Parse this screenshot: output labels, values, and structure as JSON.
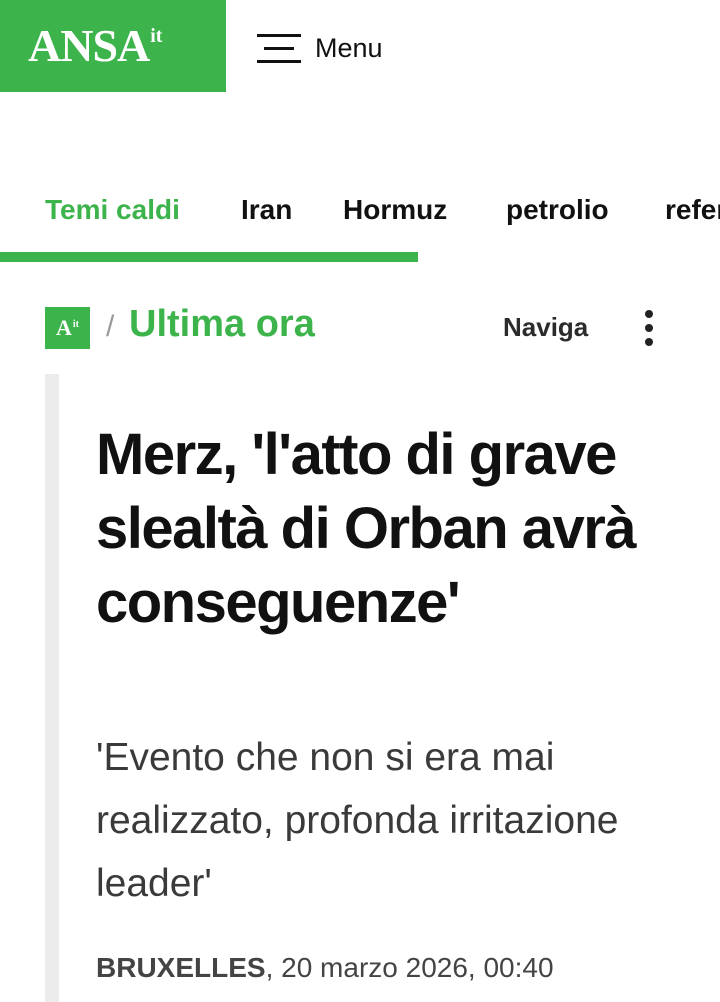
{
  "colors": {
    "brand_green": "#3cb44b"
  },
  "header": {
    "logo_text": "ANSA",
    "logo_superscript": "it",
    "menu_icon": "hamburger-icon",
    "menu_label": "Menu"
  },
  "topics": {
    "items": [
      "Temi caldi",
      "Iran",
      "Hormuz",
      "petrolio",
      "referendum"
    ],
    "active": "Temi caldi"
  },
  "breadcrumb": {
    "badge_text": "A",
    "badge_sup": "it",
    "separator": "/",
    "section": "Ultima ora",
    "naviga_label": "Naviga",
    "more_icon": "kebab-menu-icon"
  },
  "article": {
    "headline": "Merz, 'l'atto di grave slealtà di Orban avrà conseguenze'",
    "subtitle": "'Evento che non si era mai realizzato, profonda irritazione leader'",
    "place": "BRUXELLES",
    "date": ", 20 marzo 2026, 00:40"
  }
}
